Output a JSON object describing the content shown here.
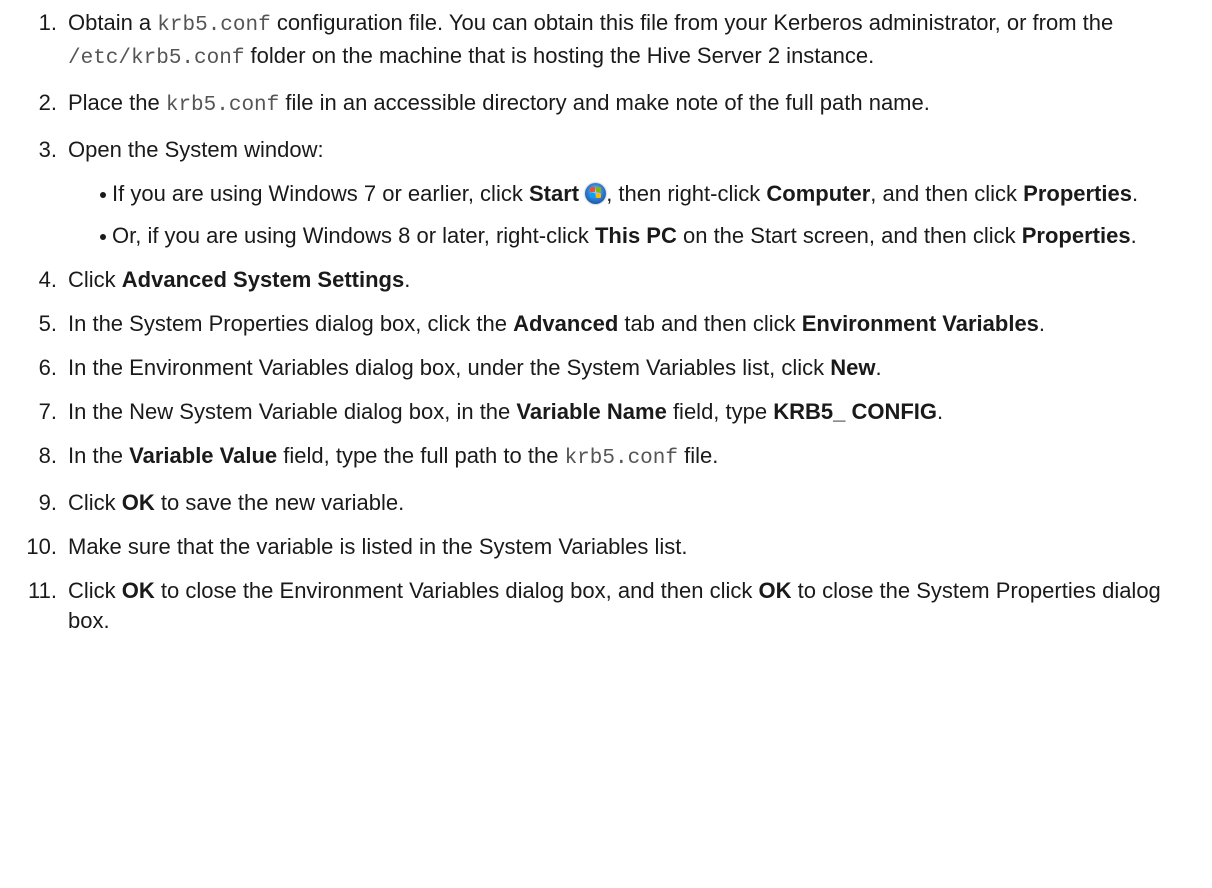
{
  "steps": [
    {
      "num": "1.",
      "p1": "Obtain a ",
      "code1": "krb5.conf",
      "p2": " configuration file. You can obtain this file from your Kerberos administrator, or from the ",
      "code2": "/etc/krb5.conf",
      "p3": " folder on the machine that is hosting the Hive Server 2 instance."
    },
    {
      "num": "2.",
      "p1": "Place the ",
      "code1": "krb5.conf",
      "p2": " file in an accessible directory and make note of the full path name."
    },
    {
      "num": "3.",
      "p1": "Open the System window:",
      "sub": [
        {
          "p1": "If you are using Windows 7 or earlier, click ",
          "b1": "Start",
          "icon": "windows-start-orb-icon",
          "p2": ", then right-click ",
          "b2": "Computer",
          "p3": ", and then click ",
          "b3": "Properties",
          "p4": "."
        },
        {
          "p1": "Or, if you are using Windows 8 or later, right-click ",
          "b1": "This PC",
          "p2": " on the Start screen, and then click ",
          "b2": "Properties",
          "p3": "."
        }
      ]
    },
    {
      "num": "4.",
      "p1": "Click ",
      "b1": "Advanced System Settings",
      "p2": "."
    },
    {
      "num": "5.",
      "p1": "In the System Properties dialog box, click the ",
      "b1": "Advanced",
      "p2": " tab and then click ",
      "b2": "Environment Variables",
      "p3": "."
    },
    {
      "num": "6.",
      "p1": "In the Environment Variables dialog box, under the System Variables list, click ",
      "b1": "New",
      "p2": "."
    },
    {
      "num": "7.",
      "p1": "In the New System Variable dialog box, in the ",
      "b1": "Variable Name",
      "p2": " field, type ",
      "b2": "KRB5_ CONFIG",
      "p3": "."
    },
    {
      "num": "8.",
      "p1": "In the ",
      "b1": "Variable Value",
      "p2": " field, type the full path to the ",
      "code1": "krb5.conf",
      "p3": " file."
    },
    {
      "num": "9.",
      "p1": "Click ",
      "b1": "OK",
      "p2": " to save the new variable."
    },
    {
      "num": "10.",
      "p1": "Make sure that the variable is listed in the System Variables list."
    },
    {
      "num": "11.",
      "p1": "Click ",
      "b1": "OK",
      "p2": " to close the Environment Variables dialog box, and then click ",
      "b2": "OK",
      "p3": " to close the System Properties dialog box."
    }
  ]
}
